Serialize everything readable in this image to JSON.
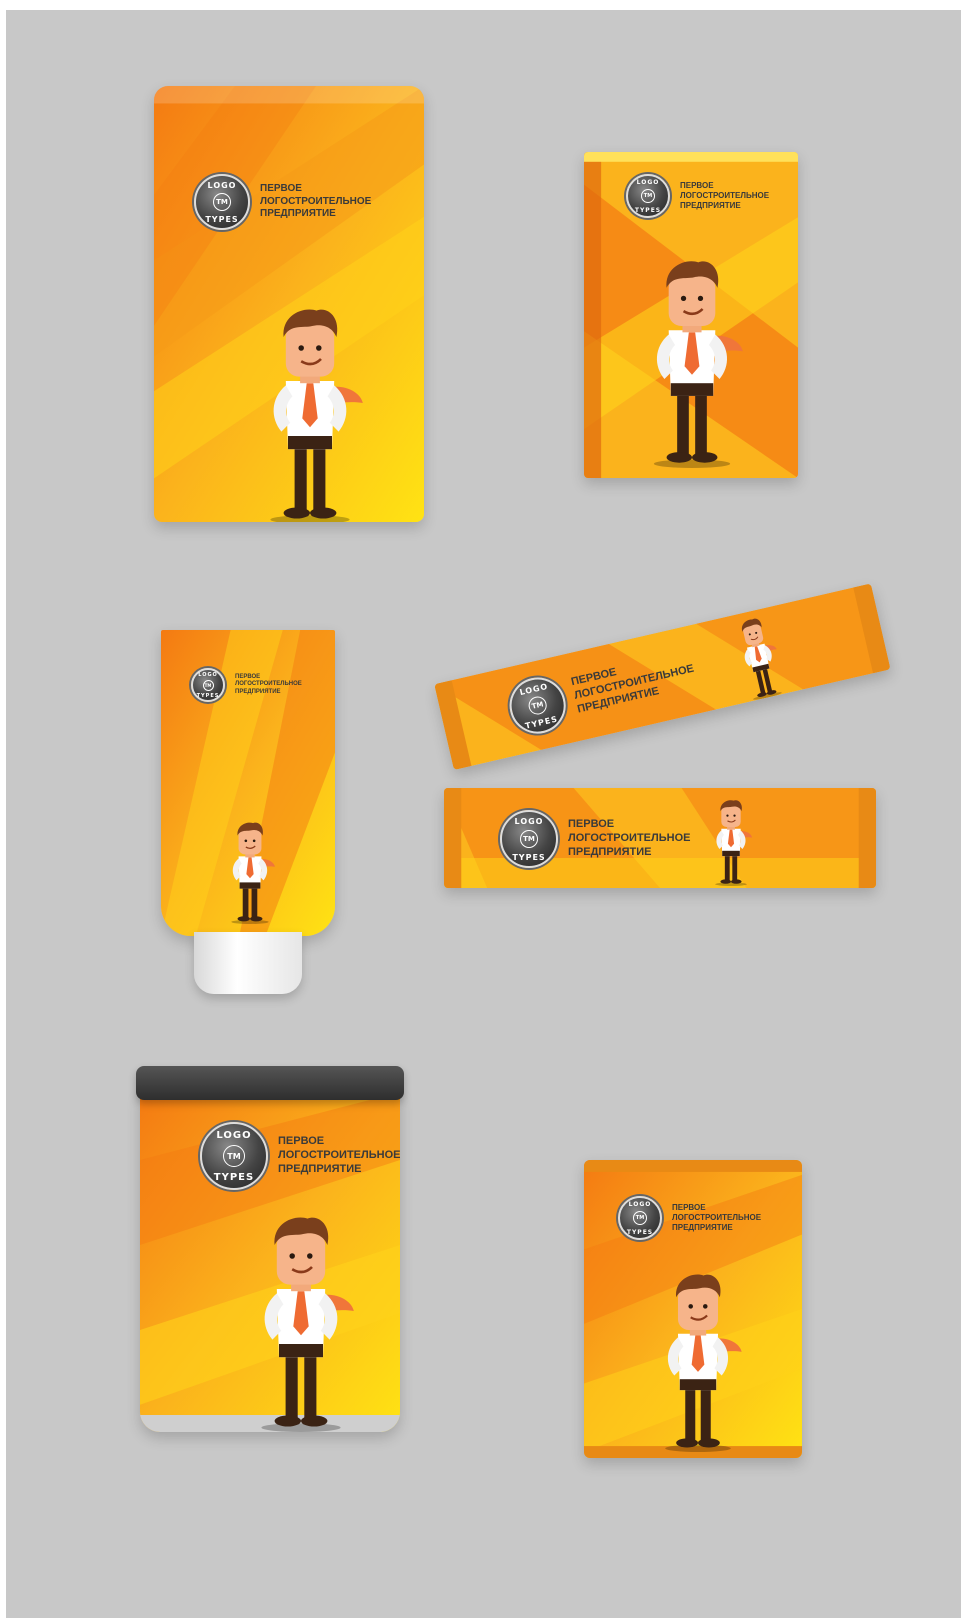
{
  "brand": {
    "logo_top": "LOGO",
    "logo_bottom": "TYPES",
    "logo_mark": "TM",
    "line1": "ПЕРВОЕ",
    "line2": "ЛОГОСТРОИТЕЛЬНОЕ",
    "line3": "ПРЕДПРИЯТИЕ"
  },
  "colors": {
    "background": "#c8c8c8",
    "orange": "#f47a12",
    "yellow": "#ffd21a",
    "cap": "#f4f4f4",
    "lid": "#3c3c3c"
  },
  "packages": [
    "pouch-bag",
    "carton-box",
    "squeeze-tube",
    "stick-sachets",
    "tin-can",
    "flow-pack"
  ]
}
